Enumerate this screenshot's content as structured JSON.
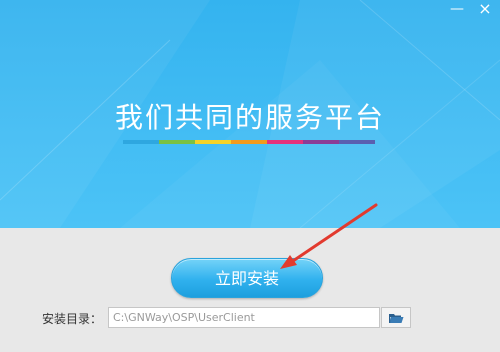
{
  "window": {
    "minimize_glyph": "—",
    "close_glyph": "×"
  },
  "hero": {
    "slogan": "我们共同的服务平台",
    "color_bar": [
      "#2ea7e0",
      "#7ac143",
      "#f5d327",
      "#f29b1d",
      "#e4327b",
      "#8b3d96",
      "#5a5fb0"
    ]
  },
  "install": {
    "button_label": "立即安装"
  },
  "directory": {
    "label": "安装目录：",
    "value": "C:\\GNWay\\OSP\\UserClient",
    "browse_icon": "folder-open-icon"
  },
  "colors": {
    "hero_bg": "#3ebaf2",
    "footer_bg": "#e8e8e8",
    "button": "#30b1ee",
    "arrow": "#e23a2e"
  }
}
